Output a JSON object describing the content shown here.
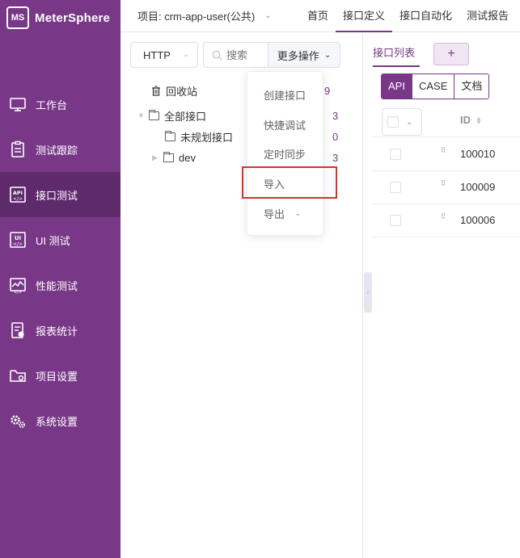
{
  "app": {
    "logo_mark": "MS",
    "name": "MeterSphere"
  },
  "colors": {
    "brand": "#783887",
    "highlight": "#d9302b"
  },
  "sidebar": {
    "items": [
      {
        "label": "工作台",
        "icon": "monitor-icon"
      },
      {
        "label": "测试跟踪",
        "icon": "clipboard-icon"
      },
      {
        "label": "接口测试",
        "icon": "api-icon",
        "active": true
      },
      {
        "label": "UI 测试",
        "icon": "ui-icon"
      },
      {
        "label": "性能测试",
        "icon": "performance-icon"
      },
      {
        "label": "报表统计",
        "icon": "report-icon"
      },
      {
        "label": "项目设置",
        "icon": "folder-settings-icon"
      },
      {
        "label": "系统设置",
        "icon": "gears-icon"
      }
    ]
  },
  "header": {
    "project_label": "项目: crm-app-user(公共)",
    "nav": [
      {
        "label": "首页"
      },
      {
        "label": "接口定义",
        "active": true
      },
      {
        "label": "接口自动化"
      },
      {
        "label": "测试报告"
      }
    ]
  },
  "toolbar": {
    "protocol": "HTTP",
    "search_placeholder": "搜索",
    "more_actions": "更多操作"
  },
  "tree": {
    "recycle": {
      "label": "回收站",
      "count": "9"
    },
    "all": {
      "label": "全部接口",
      "count": "3"
    },
    "children": [
      {
        "label": "未规划接口",
        "count": "0"
      },
      {
        "label": "dev",
        "count": "3"
      }
    ]
  },
  "dropdown": {
    "items": [
      "创建接口",
      "快捷调试",
      "定时同步",
      "导入",
      "导出"
    ]
  },
  "api_panel": {
    "tab_label": "接口列表",
    "add_label": "+",
    "segments": [
      "API",
      "CASE",
      "文档"
    ],
    "active_segment": "API",
    "table": {
      "id_header": "ID",
      "rows": [
        {
          "id": "100010"
        },
        {
          "id": "100009"
        },
        {
          "id": "100006"
        }
      ]
    }
  }
}
